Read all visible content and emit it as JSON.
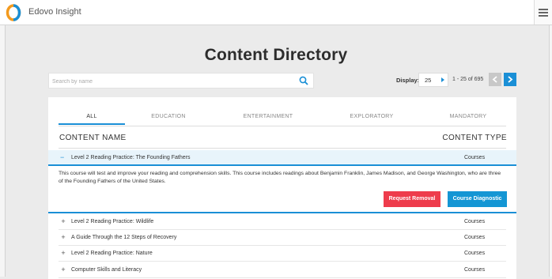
{
  "app": {
    "title": "Edovo Insight"
  },
  "page": {
    "title": "Content Directory"
  },
  "search": {
    "placeholder": "Search by name"
  },
  "pagination": {
    "display_label": "Display:",
    "page_size": "25",
    "range": "1 - 25 of 695"
  },
  "tabs": [
    "ALL",
    "EDUCATION",
    "ENTERTAINMENT",
    "EXPLORATORY",
    "MANDATORY"
  ],
  "table": {
    "col_name": "CONTENT NAME",
    "col_type": "CONTENT TYPE"
  },
  "expanded_row": {
    "symbol": "−",
    "name": "Level 2 Reading Practice: The Founding Fathers",
    "type": "Courses",
    "description": "This course will test and improve your reading and comprehension skills. This course includes readings about Benjamin Franklin, James Madison, and George Washington, who are three of the Founding Fathers of the United States.",
    "remove_label": "Request Removal",
    "diagnostic_label": "Course Diagnostic"
  },
  "rows": [
    {
      "symbol": "+",
      "name": "Level 2 Reading Practice: Wildlife",
      "type": "Courses"
    },
    {
      "symbol": "+",
      "name": "A Guide Through the 12 Steps of Recovery",
      "type": "Courses"
    },
    {
      "symbol": "+",
      "name": "Level 2 Reading Practice: Nature",
      "type": "Courses"
    },
    {
      "symbol": "+",
      "name": "Computer Skills and Literacy",
      "type": "Courses"
    }
  ],
  "colors": {
    "accent": "#1a8fd6",
    "danger": "#ee3c4c",
    "logo_orange": "#f39a1e"
  },
  "icons": {
    "logo": "edovo-logo-icon",
    "search": "search-icon",
    "menu": "hamburger-menu-icon",
    "prev": "chevron-left-icon",
    "next": "chevron-right-icon"
  }
}
